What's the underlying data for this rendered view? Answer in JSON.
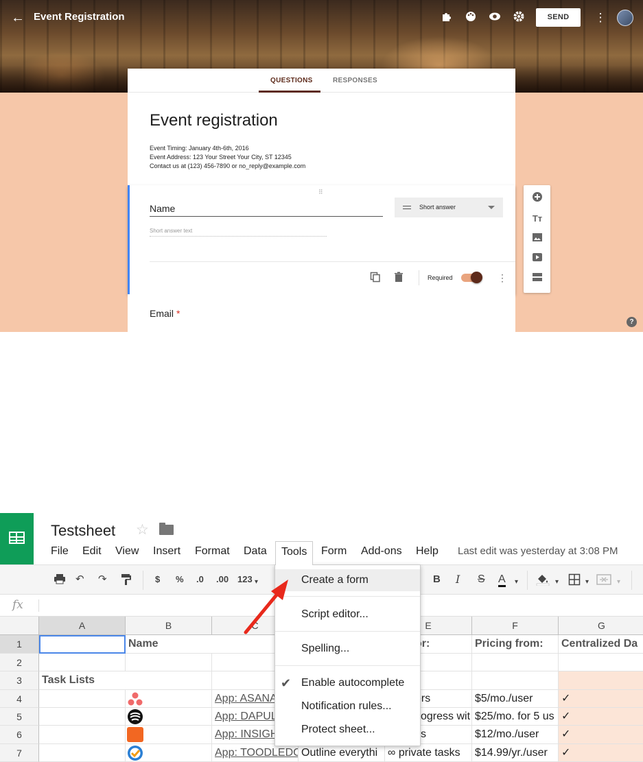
{
  "forms": {
    "title": "Event Registration",
    "send_label": "SEND",
    "tabs": [
      {
        "label": "QUESTIONS"
      },
      {
        "label": "RESPONSES"
      }
    ],
    "form_title": "Event registration",
    "description_lines": [
      "Event Timing: January 4th-6th, 2016",
      "Event Address: 123 Your Street Your City, ST 12345",
      "Contact us at (123) 456-7890 or no_reply@example.com"
    ],
    "question": {
      "title": "Name",
      "type": "Short answer",
      "placeholder": "Short answer text",
      "required_label": "Required",
      "required": true
    },
    "next_question": {
      "title": "Email",
      "required_mark": "*"
    },
    "help_glyph": "?",
    "accent_color": "#5d2a1a",
    "background_color": "#f6c7a9"
  },
  "sheets": {
    "title": "Testsheet",
    "menu": [
      "File",
      "Edit",
      "View",
      "Insert",
      "Format",
      "Data",
      "Tools",
      "Form",
      "Add-ons",
      "Help"
    ],
    "last_edit": "Last edit was yesterday at 3:08 PM",
    "toolbar": {
      "currency": "$",
      "percent": "%",
      "decimal_less": ".0",
      "decimal_more": ".00",
      "number_format": "123",
      "bold": "B",
      "italic": "I",
      "strike": "S",
      "text_color": "A"
    },
    "fx": "fx",
    "columns": [
      "A",
      "B",
      "C",
      "D",
      "E",
      "F",
      "G"
    ],
    "rows": [
      "1",
      "2",
      "3",
      "4",
      "5",
      "6",
      "7"
    ],
    "cells": {
      "b1": "Name",
      "e1": "or:",
      "f1": "Pricing from:",
      "g1": "Centralized Da",
      "a3": "Task Lists",
      "c4": "App: ASANA",
      "e4": "ers",
      "f4": "$5/mo./user",
      "g4": "✓",
      "c5": "App: DAPUL",
      "e5": "ogress wit",
      "f5": "$25/mo. for 5 us",
      "g5": "✓",
      "c6": "App: INSIGH",
      "e6": "s",
      "f6": "$12/mo./user",
      "g6": "✓",
      "c7": "App: TOODLEDC",
      "d7": "Outline everythi",
      "e7": "∞ private tasks",
      "f7": "$14.99/yr./user",
      "g7": "✓"
    },
    "tools_menu": {
      "create_form": "Create a form",
      "script_editor": "Script editor...",
      "spelling": "Spelling...",
      "autocomplete": "Enable autocomplete",
      "autocomplete_checked": true,
      "notification_rules": "Notification rules...",
      "protect_sheet": "Protect sheet..."
    },
    "brand_color": "#0f9d58"
  }
}
